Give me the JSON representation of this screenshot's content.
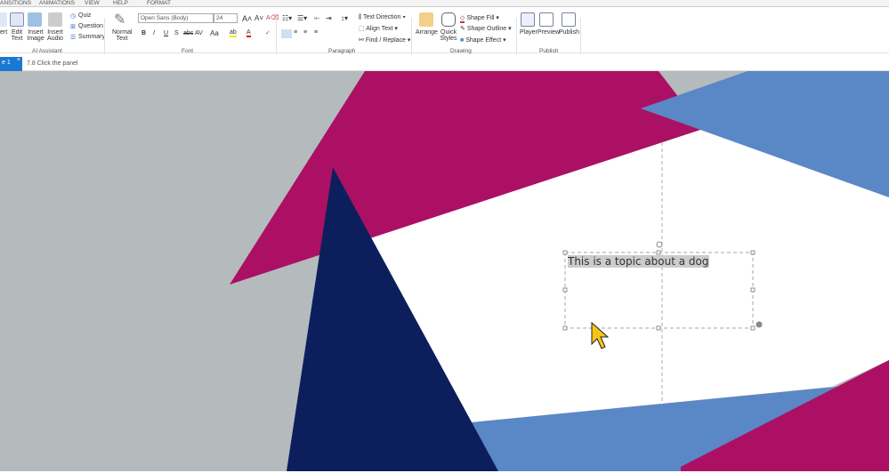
{
  "tabs": [
    "ANSITIONS",
    "ANIMATIONS",
    "VIEW",
    "HELP",
    "FORMAT"
  ],
  "ribbon": {
    "ai": {
      "items": [
        "ert",
        "Edit Text",
        "Insert Image",
        "Insert Audio"
      ],
      "quiz": "Quiz",
      "question": "Question",
      "summary": "Summary",
      "group": "AI Assistant"
    },
    "font": {
      "normal_text": "Normal Text",
      "font_name": "Open Sans (Body)",
      "font_size": "24",
      "group": "Font",
      "buttons": [
        "B",
        "I",
        "U",
        "S",
        "abc",
        "AV",
        "Aa"
      ]
    },
    "paragraph": {
      "text_direction": "Text Direction",
      "align_text": "Align Text",
      "find_replace": "Find / Replace",
      "group": "Paragraph"
    },
    "drawing": {
      "arrange": "Arrange",
      "quick_styles": "Quick Styles",
      "shape_fill": "Shape Fill",
      "shape_outline": "Shape Outline",
      "shape_effect": "Shape Effect",
      "group": "Drawing"
    },
    "publish": {
      "player": "Player",
      "preview": "Preview",
      "publish": "Publish",
      "group": "Publish"
    }
  },
  "slide_tab": {
    "label": "e 1",
    "close": "×"
  },
  "breadcrumb": "7.8 Click the panel",
  "slide": {
    "text": "This is a topic about a dog"
  },
  "colors": {
    "magenta": "#ac1064",
    "navy": "#0c1f5c",
    "blue": "#5a87c5",
    "gray": "#b5babd"
  }
}
